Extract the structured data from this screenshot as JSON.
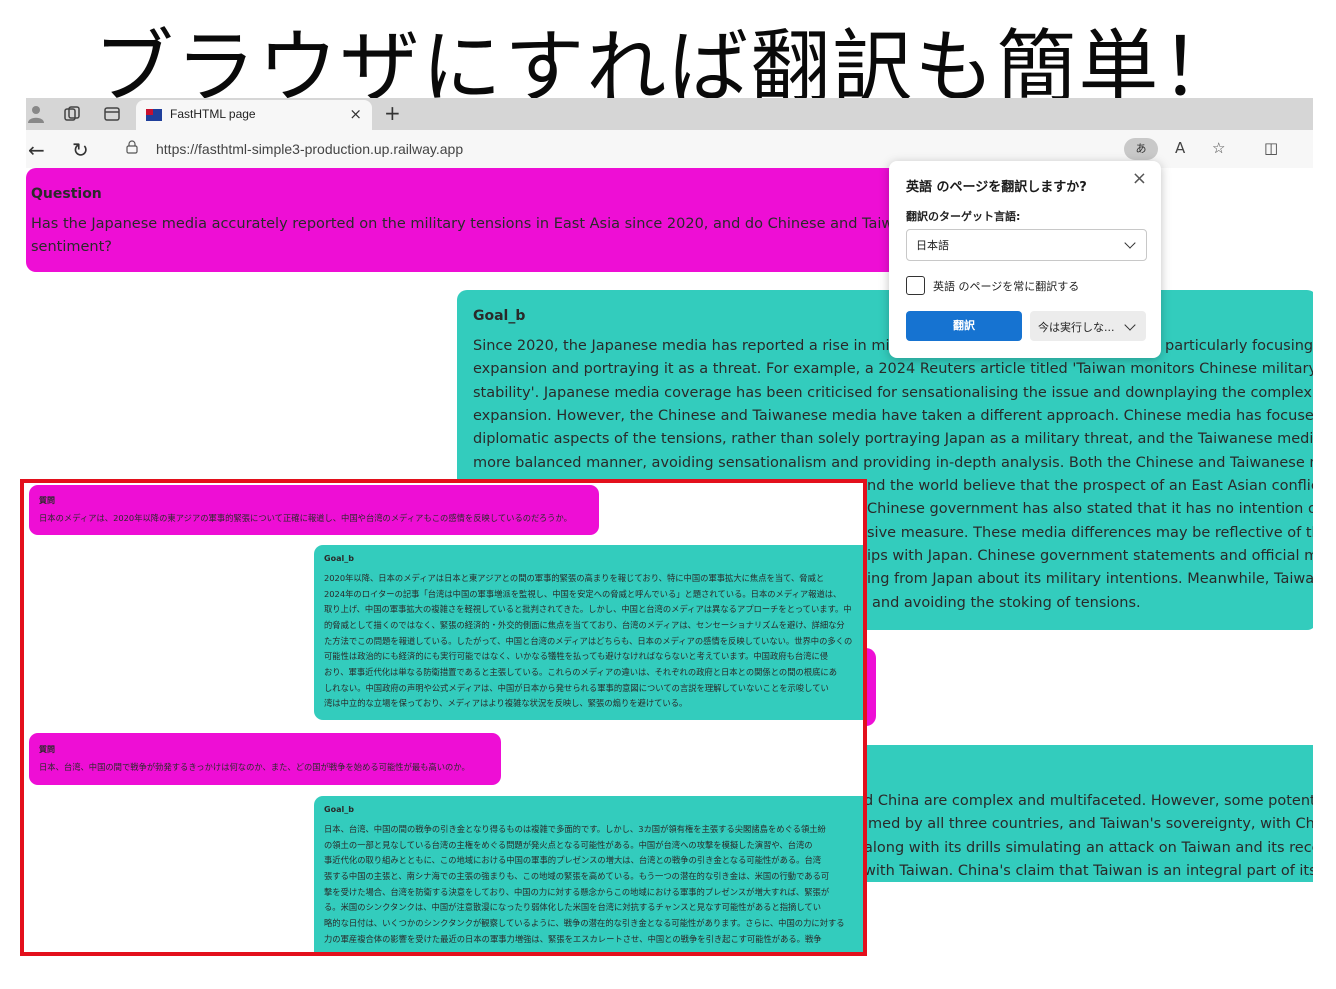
{
  "headline": "ブラウザにすれば翻訳も簡単！",
  "browser": {
    "tab_title": "FastHTML page",
    "tab_close": "×",
    "new_tab": "+",
    "url": "https://fasthtml-simple3-production.up.railway.app",
    "back": "←",
    "reload": "↻",
    "translate_pill": "あ",
    "read_aloud": "A",
    "favorite": "☆",
    "split": "◫"
  },
  "page": {
    "question_label": "Question",
    "question_lines": [
      "Has the Japanese media accurately reported on the military tensions in East Asia since 2020, and do Chinese and Taiwanese m",
      "sentiment?"
    ],
    "goal_label": "Goal_b",
    "goal_lines": [
      "Since 2020, the Japanese media has reported a rise in military",
      "expansion and portraying it as a threat. For example, a 2024 Reuters article titled 'Taiwan monitors Chinese military surge, c",
      "stability'. Japanese media coverage has been criticised for sensationalising the issue and downplaying the complexities of C",
      "expansion. However, the Chinese and Taiwanese media have taken a different approach. Chinese media has focused on the",
      "diplomatic aspects of the tensions, rather than solely portraying Japan as a military threat, and the Taiwanese media has rep",
      "more balanced manner, avoiding sensationalism and providing in-depth analysis. Both the Chinese and Taiwanese media, t"
    ],
    "goal_line1_tail": "particularly focusing o",
    "goal_visible_tail": [
      "nd the world believe that the prospect of an East Asian conflict is n",
      "Chinese government has also stated that it has no intention of in",
      "sive measure. These media differences may be reflective of the un",
      "ips with Japan. Chinese government statements and official media",
      "ing from Japan about its military intentions. Meanwhile, Taiwan m",
      "and avoiding the stoking of tensions."
    ],
    "goal2_visible_tail": [
      "d China are complex and multifaceted. However, some potential f",
      "imed by all three countries, and Taiwan's sovereignty, with China",
      "along with its drills simulating an attack on Taiwan and its recent",
      "with Taiwan. China's claim that Taiwan is an integral part of its terr"
    ]
  },
  "popup": {
    "title": "英語 のページを翻訳しますか?",
    "close": "×",
    "target_label": "翻訳のターゲット言語:",
    "target_value": "日本語",
    "always_label": "英語 のページを常に翻訳する",
    "always_checked": false,
    "translate_button": "翻訳",
    "later_button": "今は実行しな..."
  },
  "inset": {
    "q1_label": "質問",
    "q1_text": "日本のメディアは、2020年以降の東アジアの軍事的緊張について正確に報道し、中国や台湾のメディアもこの感情を反映しているのだろうか。",
    "g1_label": "Goal_b",
    "g1_lines": [
      "2020年以降、日本のメディアは日本と東アジアとの間の軍事的緊張の高まりを報じており、特に中国の軍事拡大に焦点を当て、脅威と",
      "2024年のロイターの記事「台湾は中国の軍事増派を監視し、中国を安定への脅威と呼んでいる」と題されている。日本のメディア報道は、",
      "取り上げ、中国の軍事拡大の複雑さを軽視していると批判されてきた。しかし、中国と台湾のメディアは異なるアプローチをとっています。中",
      "的脅威として描くのではなく、緊張の経済的・外交的側面に焦点を当てており、台湾のメディアは、センセーショナリズムを避け、詳細な分",
      "た方法でこの問題を報道している。したがって、中国と台湾のメディアはどちらも、日本のメディアの感情を反映していない。世界中の多くの",
      "可能性は政治的にも経済的にも実行可能ではなく、いかなる犠牲を払っても避けなければならないと考えています。中国政府も台湾に侵",
      "おり、軍事近代化は単なる防衛措置であると主張している。これらのメディアの違いは、それぞれの政府と日本との関係との間の根底にあ",
      "しれない。中国政府の声明や公式メディアは、中国が日本から発せられる軍事的意図についての言説を理解していないことを示唆してい",
      "湾は中立的な立場を保っており、メディアはより複雑な状況を反映し、緊張の煽りを避けている。"
    ],
    "q2_label": "質問",
    "q2_text": "日本、台湾、中国の間で戦争が勃発するきっかけは何なのか、また、どの国が戦争を始める可能性が最も高いのか。",
    "g2_label": "Goal_b",
    "g2_lines": [
      "日本、台湾、中国の間の戦争の引き金となり得るものは複雑で多面的です。しかし、3カ国が領有権を主張する尖閣諸島をめぐる領土紛",
      "の領土の一部と見なしている台湾の主権をめぐる問題が発火点となる可能性がある。中国が台湾への攻撃を模擬した演習や、台湾の",
      "事近代化の取り組みとともに、この地域における中国の軍事的プレゼンスの増大は、台湾との戦争の引き金となる可能性がある。台湾",
      "張する中国の主張と、南シナ海での主張の強まりも、この地域の緊張を高めている。もう一つの潜在的な引き金は、米国の行動である可",
      "撃を受けた場合、台湾を防衛する決意をしており、中国の力に対する懸念からこの地域における軍事的プレゼンスが増大すれば、緊張が",
      "る。米国のシンクタンクは、中国が注意散漫になったり弱体化した米国を台湾に対抗するチャンスと見なす可能性があると指摘してい",
      "略的な日付は、いくつかのシンクタンクが観察しているように、戦争の潜在的な引き金となる可能性があります。さらに、中国の力に対する",
      "力の軍産複合体の影響を受けた最近の日本の軍事力増強は、緊張をエスカレートさせ、中国との戦争を引き起こす可能性がある。戦争"
    ]
  },
  "colors": {
    "question_bg": "#ee0ed5",
    "goal_bg": "#33ccbd",
    "highlight_border": "#e3101c",
    "translate_btn": "#1673d1"
  }
}
